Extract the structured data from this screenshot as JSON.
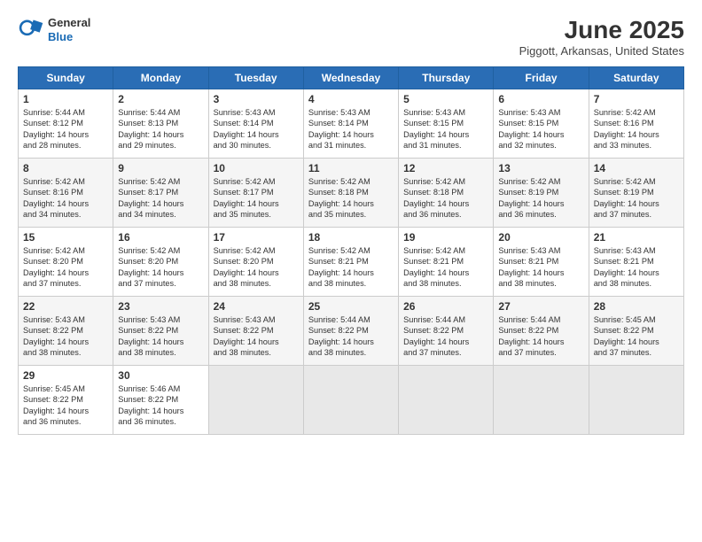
{
  "logo": {
    "general": "General",
    "blue": "Blue"
  },
  "header": {
    "month": "June 2025",
    "location": "Piggott, Arkansas, United States"
  },
  "weekdays": [
    "Sunday",
    "Monday",
    "Tuesday",
    "Wednesday",
    "Thursday",
    "Friday",
    "Saturday"
  ],
  "weeks": [
    [
      {
        "day": "1",
        "lines": [
          "Sunrise: 5:44 AM",
          "Sunset: 8:12 PM",
          "Daylight: 14 hours",
          "and 28 minutes."
        ]
      },
      {
        "day": "2",
        "lines": [
          "Sunrise: 5:44 AM",
          "Sunset: 8:13 PM",
          "Daylight: 14 hours",
          "and 29 minutes."
        ]
      },
      {
        "day": "3",
        "lines": [
          "Sunrise: 5:43 AM",
          "Sunset: 8:14 PM",
          "Daylight: 14 hours",
          "and 30 minutes."
        ]
      },
      {
        "day": "4",
        "lines": [
          "Sunrise: 5:43 AM",
          "Sunset: 8:14 PM",
          "Daylight: 14 hours",
          "and 31 minutes."
        ]
      },
      {
        "day": "5",
        "lines": [
          "Sunrise: 5:43 AM",
          "Sunset: 8:15 PM",
          "Daylight: 14 hours",
          "and 31 minutes."
        ]
      },
      {
        "day": "6",
        "lines": [
          "Sunrise: 5:43 AM",
          "Sunset: 8:15 PM",
          "Daylight: 14 hours",
          "and 32 minutes."
        ]
      },
      {
        "day": "7",
        "lines": [
          "Sunrise: 5:42 AM",
          "Sunset: 8:16 PM",
          "Daylight: 14 hours",
          "and 33 minutes."
        ]
      }
    ],
    [
      {
        "day": "8",
        "lines": [
          "Sunrise: 5:42 AM",
          "Sunset: 8:16 PM",
          "Daylight: 14 hours",
          "and 34 minutes."
        ]
      },
      {
        "day": "9",
        "lines": [
          "Sunrise: 5:42 AM",
          "Sunset: 8:17 PM",
          "Daylight: 14 hours",
          "and 34 minutes."
        ]
      },
      {
        "day": "10",
        "lines": [
          "Sunrise: 5:42 AM",
          "Sunset: 8:17 PM",
          "Daylight: 14 hours",
          "and 35 minutes."
        ]
      },
      {
        "day": "11",
        "lines": [
          "Sunrise: 5:42 AM",
          "Sunset: 8:18 PM",
          "Daylight: 14 hours",
          "and 35 minutes."
        ]
      },
      {
        "day": "12",
        "lines": [
          "Sunrise: 5:42 AM",
          "Sunset: 8:18 PM",
          "Daylight: 14 hours",
          "and 36 minutes."
        ]
      },
      {
        "day": "13",
        "lines": [
          "Sunrise: 5:42 AM",
          "Sunset: 8:19 PM",
          "Daylight: 14 hours",
          "and 36 minutes."
        ]
      },
      {
        "day": "14",
        "lines": [
          "Sunrise: 5:42 AM",
          "Sunset: 8:19 PM",
          "Daylight: 14 hours",
          "and 37 minutes."
        ]
      }
    ],
    [
      {
        "day": "15",
        "lines": [
          "Sunrise: 5:42 AM",
          "Sunset: 8:20 PM",
          "Daylight: 14 hours",
          "and 37 minutes."
        ]
      },
      {
        "day": "16",
        "lines": [
          "Sunrise: 5:42 AM",
          "Sunset: 8:20 PM",
          "Daylight: 14 hours",
          "and 37 minutes."
        ]
      },
      {
        "day": "17",
        "lines": [
          "Sunrise: 5:42 AM",
          "Sunset: 8:20 PM",
          "Daylight: 14 hours",
          "and 38 minutes."
        ]
      },
      {
        "day": "18",
        "lines": [
          "Sunrise: 5:42 AM",
          "Sunset: 8:21 PM",
          "Daylight: 14 hours",
          "and 38 minutes."
        ]
      },
      {
        "day": "19",
        "lines": [
          "Sunrise: 5:42 AM",
          "Sunset: 8:21 PM",
          "Daylight: 14 hours",
          "and 38 minutes."
        ]
      },
      {
        "day": "20",
        "lines": [
          "Sunrise: 5:43 AM",
          "Sunset: 8:21 PM",
          "Daylight: 14 hours",
          "and 38 minutes."
        ]
      },
      {
        "day": "21",
        "lines": [
          "Sunrise: 5:43 AM",
          "Sunset: 8:21 PM",
          "Daylight: 14 hours",
          "and 38 minutes."
        ]
      }
    ],
    [
      {
        "day": "22",
        "lines": [
          "Sunrise: 5:43 AM",
          "Sunset: 8:22 PM",
          "Daylight: 14 hours",
          "and 38 minutes."
        ]
      },
      {
        "day": "23",
        "lines": [
          "Sunrise: 5:43 AM",
          "Sunset: 8:22 PM",
          "Daylight: 14 hours",
          "and 38 minutes."
        ]
      },
      {
        "day": "24",
        "lines": [
          "Sunrise: 5:43 AM",
          "Sunset: 8:22 PM",
          "Daylight: 14 hours",
          "and 38 minutes."
        ]
      },
      {
        "day": "25",
        "lines": [
          "Sunrise: 5:44 AM",
          "Sunset: 8:22 PM",
          "Daylight: 14 hours",
          "and 38 minutes."
        ]
      },
      {
        "day": "26",
        "lines": [
          "Sunrise: 5:44 AM",
          "Sunset: 8:22 PM",
          "Daylight: 14 hours",
          "and 37 minutes."
        ]
      },
      {
        "day": "27",
        "lines": [
          "Sunrise: 5:44 AM",
          "Sunset: 8:22 PM",
          "Daylight: 14 hours",
          "and 37 minutes."
        ]
      },
      {
        "day": "28",
        "lines": [
          "Sunrise: 5:45 AM",
          "Sunset: 8:22 PM",
          "Daylight: 14 hours",
          "and 37 minutes."
        ]
      }
    ],
    [
      {
        "day": "29",
        "lines": [
          "Sunrise: 5:45 AM",
          "Sunset: 8:22 PM",
          "Daylight: 14 hours",
          "and 36 minutes."
        ]
      },
      {
        "day": "30",
        "lines": [
          "Sunrise: 5:46 AM",
          "Sunset: 8:22 PM",
          "Daylight: 14 hours",
          "and 36 minutes."
        ]
      },
      {
        "day": "",
        "lines": []
      },
      {
        "day": "",
        "lines": []
      },
      {
        "day": "",
        "lines": []
      },
      {
        "day": "",
        "lines": []
      },
      {
        "day": "",
        "lines": []
      }
    ]
  ]
}
